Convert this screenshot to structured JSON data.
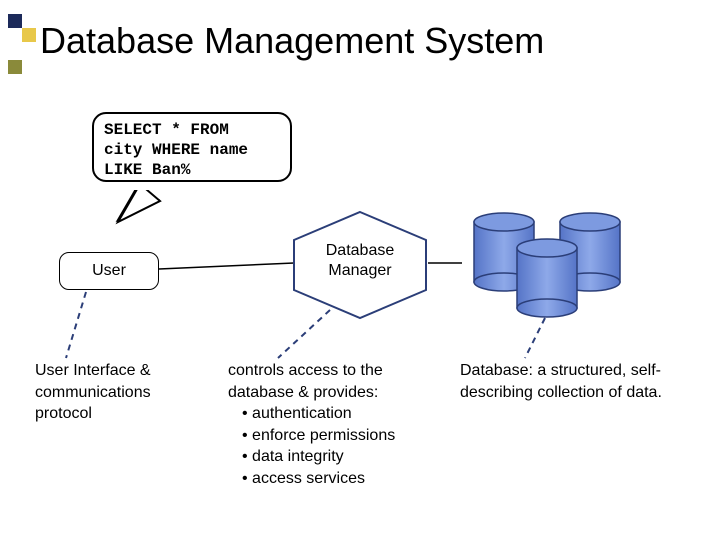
{
  "title": "Database Management System",
  "query": "SELECT * FROM\ncity WHERE name\nLIKE Ban%",
  "user_label": "User",
  "db_manager": {
    "line1": "Database",
    "line2": "Manager"
  },
  "desc_left": "User Interface & communications protocol",
  "desc_mid": {
    "lead": "controls access to the database & provides:",
    "items": [
      "authentication",
      "enforce permissions",
      "data integrity",
      "access services"
    ]
  },
  "desc_right": "Database: a structured, self-describing collection of data.",
  "colors": {
    "cyl_fill": "#6a8fe0",
    "cyl_stroke": "#2b3e78",
    "hex_stroke": "#2b3e78",
    "dash": "#2b3e78",
    "deco": {
      "navy": "#1c2a5a",
      "yellow": "#e8c84a",
      "olive": "#8a8a3a"
    }
  }
}
